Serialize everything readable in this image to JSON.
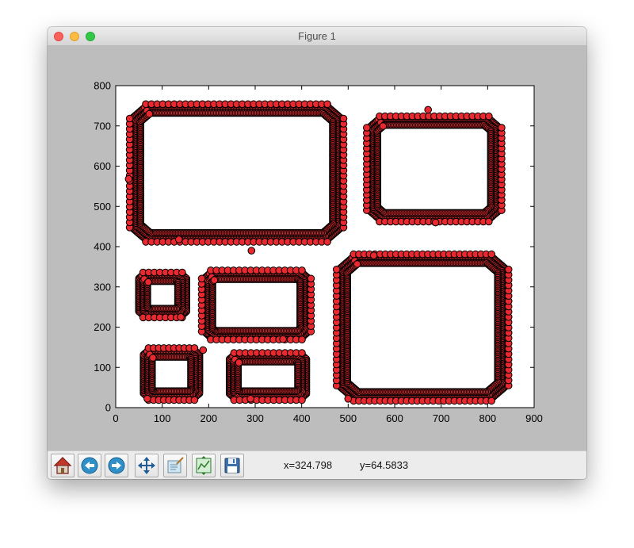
{
  "window": {
    "title": "Figure 1"
  },
  "toolbar": {
    "buttons": [
      {
        "name": "home-button",
        "icon": "home-icon"
      },
      {
        "name": "back-button",
        "icon": "back-arrow-icon"
      },
      {
        "name": "forward-button",
        "icon": "forward-arrow-icon"
      },
      {
        "name": "pan-button",
        "icon": "move-icon"
      },
      {
        "name": "zoom-button",
        "icon": "zoom-rect-icon"
      },
      {
        "name": "subplots-button",
        "icon": "configure-subplots-icon"
      },
      {
        "name": "save-button",
        "icon": "save-icon"
      }
    ],
    "x_readout": "x=324.798",
    "y_readout": "y=64.5833"
  },
  "colors": {
    "marker_fill": "#e8292f",
    "marker_edge": "#000000",
    "figure_bg": "#bdbdbd",
    "axes_bg": "#ffffff"
  },
  "chart_data": {
    "type": "scatter",
    "title": "",
    "xlabel": "",
    "ylabel": "",
    "xlim": [
      0,
      900
    ],
    "ylim": [
      0,
      800
    ],
    "xticks": [
      0,
      100,
      200,
      300,
      400,
      500,
      600,
      700,
      800,
      900
    ],
    "yticks": [
      0,
      100,
      200,
      300,
      400,
      500,
      600,
      700,
      800
    ],
    "grid": false,
    "marker": "circle",
    "shapes": [
      {
        "kind": "large-rounded-rect",
        "x": [
          35,
          485
        ],
        "y": [
          418,
          748
        ]
      },
      {
        "kind": "rounded-rect",
        "x": [
          545,
          825
        ],
        "y": [
          468,
          718
        ]
      },
      {
        "kind": "small-rect",
        "x": [
          50,
          152
        ],
        "y": [
          230,
          330
        ]
      },
      {
        "kind": "wide-rect",
        "x": [
          190,
          415
        ],
        "y": [
          175,
          335
        ]
      },
      {
        "kind": "notched-square",
        "x": [
          480,
          840
        ],
        "y": [
          23,
          375
        ]
      },
      {
        "kind": "small-rect",
        "x": [
          60,
          180
        ],
        "y": [
          25,
          142
        ]
      },
      {
        "kind": "rect",
        "x": [
          245,
          410
        ],
        "y": [
          25,
          130
        ]
      }
    ],
    "outliers": [
      {
        "x": 28,
        "y": 568
      },
      {
        "x": 136,
        "y": 418
      },
      {
        "x": 292,
        "y": 390
      },
      {
        "x": 688,
        "y": 460
      },
      {
        "x": 672,
        "y": 740
      },
      {
        "x": 140,
        "y": 225
      },
      {
        "x": 188,
        "y": 143
      },
      {
        "x": 360,
        "y": 170
      },
      {
        "x": 68,
        "y": 22
      },
      {
        "x": 290,
        "y": 22
      },
      {
        "x": 500,
        "y": 22
      },
      {
        "x": 555,
        "y": 378
      }
    ]
  }
}
